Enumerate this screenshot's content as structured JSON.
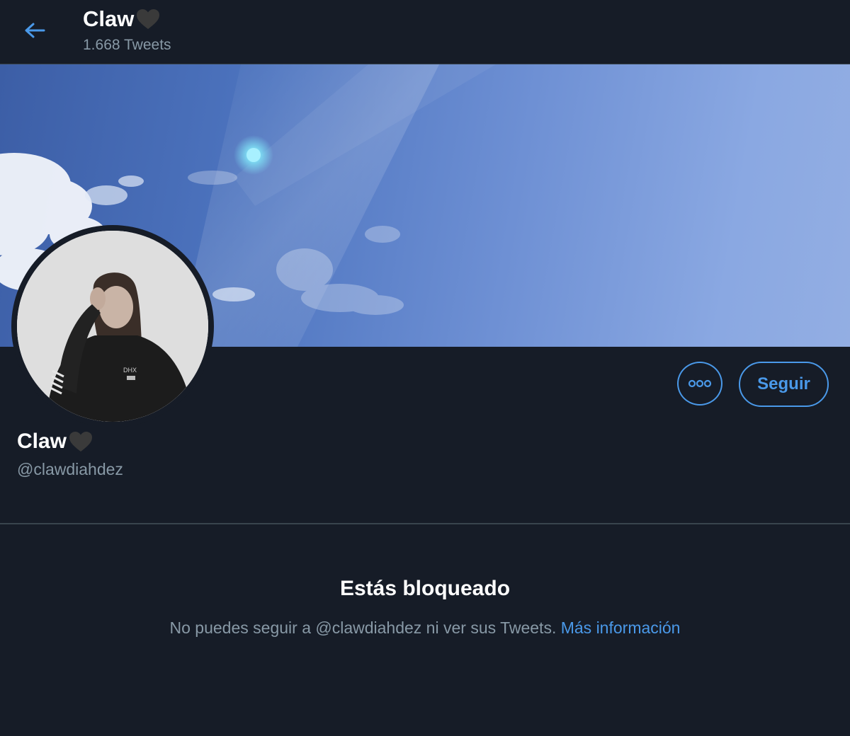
{
  "header": {
    "name": "Claw",
    "tweet_count": "1.668 Tweets"
  },
  "profile": {
    "name": "Claw",
    "handle": "@clawdiahdez"
  },
  "actions": {
    "follow_label": "Seguir"
  },
  "blocked": {
    "title": "Estás bloqueado",
    "message": "No puedes seguir a @clawdiahdez ni ver sus Tweets.",
    "link_label": "Más información"
  },
  "colors": {
    "background": "#161c27",
    "accent": "#4a99e9",
    "secondary_text": "#8899a6",
    "divider": "#38444d"
  },
  "icons": {
    "back": "arrow-left-icon",
    "more": "more-options-icon",
    "heart": "black-heart-icon"
  }
}
